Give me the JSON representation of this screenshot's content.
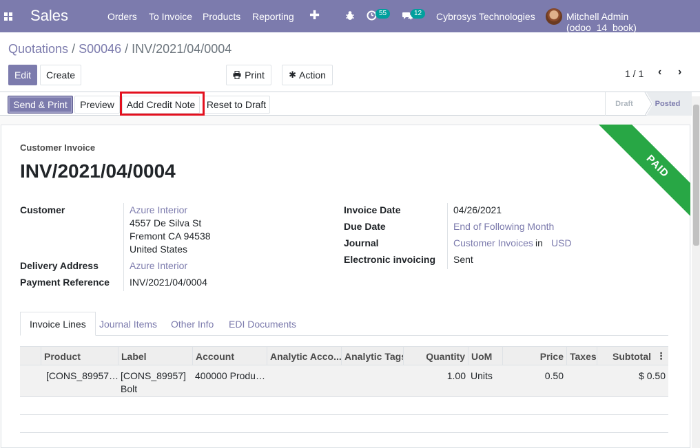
{
  "navbar": {
    "app_name": "Sales",
    "menu": [
      "Orders",
      "To Invoice",
      "Products",
      "Reporting"
    ],
    "activity_count": "55",
    "message_count": "12",
    "company": "Cybrosys Technologies",
    "user": "Mitchell Admin (odoo_14_book)",
    "icons": [
      "apps-icon",
      "plus-icon",
      "bug-icon",
      "clock-icon",
      "chat-icon"
    ]
  },
  "breadcrumb": {
    "items": [
      "Quotations",
      "S00046"
    ],
    "current": "INV/2021/04/0004",
    "separator": "/"
  },
  "control": {
    "edit": "Edit",
    "create": "Create",
    "print": "Print",
    "action": "Action",
    "pager": "1 / 1"
  },
  "statusbar": {
    "buttons": [
      "Send & Print",
      "Preview",
      "Add Credit Note",
      "Reset to Draft"
    ],
    "stages": [
      "Draft",
      "Posted"
    ],
    "current_stage": "Posted"
  },
  "invoice": {
    "type_label": "Customer Invoice",
    "number": "INV/2021/04/0004",
    "ribbon": "PAID",
    "customer_label": "Customer",
    "customer_name": "Azure Interior",
    "address": [
      "4557 De Silva St",
      "Fremont CA 94538",
      "United States"
    ],
    "delivery_label": "Delivery Address",
    "delivery_value": "Azure Interior",
    "payment_ref_label": "Payment Reference",
    "payment_ref_value": "INV/2021/04/0004",
    "invoice_date_label": "Invoice Date",
    "invoice_date_value": "04/26/2021",
    "due_date_label": "Due Date",
    "due_date_value": "End of Following Month",
    "journal_label": "Journal",
    "journal_value": "Customer Invoices",
    "journal_in": "in",
    "currency": "USD",
    "edi_label": "Electronic invoicing",
    "edi_value": "Sent"
  },
  "tabs": [
    "Invoice Lines",
    "Journal Items",
    "Other Info",
    "EDI Documents"
  ],
  "lines": {
    "columns": [
      "Product",
      "Label",
      "Account",
      "Analytic Acco...",
      "Analytic Tags",
      "Quantity",
      "UoM",
      "Price",
      "Taxes",
      "Subtotal"
    ],
    "rows": [
      {
        "product": "[CONS_89957…",
        "label_1": "[CONS_89957]",
        "label_2": "Bolt",
        "account": "400000 Produ…",
        "quantity": "1.00",
        "uom": "Units",
        "price": "0.50",
        "subtotal": "$ 0.50"
      }
    ]
  },
  "colors": {
    "brand": "#7c7bad",
    "paid_ribbon": "#28a745",
    "highlight": "#e3101e"
  }
}
